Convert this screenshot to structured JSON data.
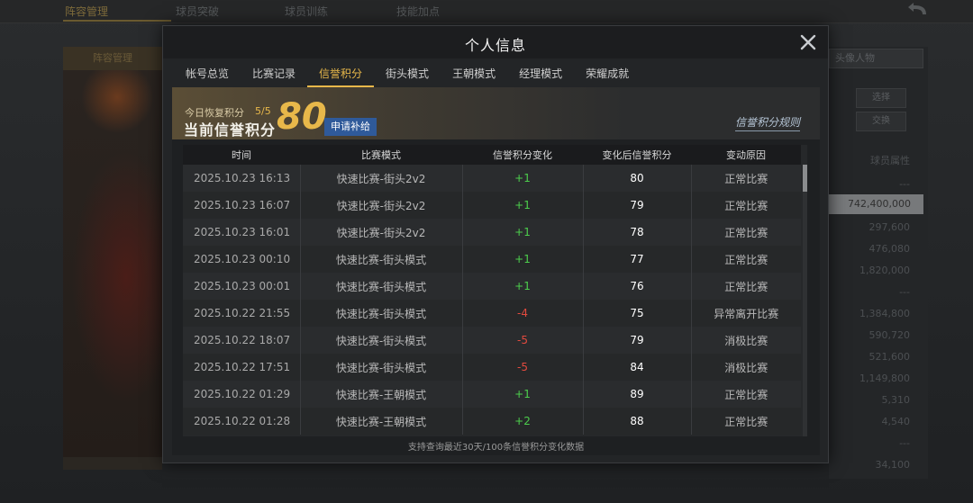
{
  "background": {
    "tabs": [
      "阵容管理",
      "球员突破",
      "球员训练",
      "技能加点"
    ],
    "left_header": "阵容管理",
    "right_select": "头像人物",
    "right_buttons": [
      "选择",
      "交换"
    ],
    "right_header": "球员属性",
    "right_values": [
      "---",
      "742,400,000",
      "297,600",
      "476,080",
      "1,820,000",
      "---",
      "1,384,800",
      "590,720",
      "521,600",
      "1,149,800",
      "5,310",
      "4,540",
      "---",
      "34,100"
    ]
  },
  "modal": {
    "title": "个人信息",
    "tabs": [
      {
        "label": "帐号总览",
        "active": false
      },
      {
        "label": "比赛记录",
        "active": false
      },
      {
        "label": "信誉积分",
        "active": true
      },
      {
        "label": "街头模式",
        "active": false
      },
      {
        "label": "王朝模式",
        "active": false
      },
      {
        "label": "经理模式",
        "active": false
      },
      {
        "label": "荣耀成就",
        "active": false
      }
    ],
    "banner": {
      "recover_label": "今日恢复积分",
      "recover_value": "5/5",
      "current_label": "当前信誉积分",
      "current_score": "80",
      "apply_button": "申请补给",
      "rules_link": "信誉积分规则"
    },
    "table": {
      "headers": [
        "时间",
        "比赛模式",
        "信誉积分变化",
        "变化后信誉积分",
        "变动原因"
      ],
      "rows": [
        {
          "time": "2025.10.23  16:13",
          "mode": "快速比赛-街头2v2",
          "change": "+1",
          "after": "80",
          "reason": "正常比赛",
          "sign": "pos"
        },
        {
          "time": "2025.10.23  16:07",
          "mode": "快速比赛-街头2v2",
          "change": "+1",
          "after": "79",
          "reason": "正常比赛",
          "sign": "pos"
        },
        {
          "time": "2025.10.23  16:01",
          "mode": "快速比赛-街头2v2",
          "change": "+1",
          "after": "78",
          "reason": "正常比赛",
          "sign": "pos"
        },
        {
          "time": "2025.10.23  00:10",
          "mode": "快速比赛-街头模式",
          "change": "+1",
          "after": "77",
          "reason": "正常比赛",
          "sign": "pos"
        },
        {
          "time": "2025.10.23  00:01",
          "mode": "快速比赛-街头模式",
          "change": "+1",
          "after": "76",
          "reason": "正常比赛",
          "sign": "pos"
        },
        {
          "time": "2025.10.22  21:55",
          "mode": "快速比赛-街头模式",
          "change": "-4",
          "after": "75",
          "reason": "异常离开比赛",
          "sign": "neg"
        },
        {
          "time": "2025.10.22  18:07",
          "mode": "快速比赛-街头模式",
          "change": "-5",
          "after": "79",
          "reason": "消极比赛",
          "sign": "neg"
        },
        {
          "time": "2025.10.22  17:51",
          "mode": "快速比赛-街头模式",
          "change": "-5",
          "after": "84",
          "reason": "消极比赛",
          "sign": "neg"
        },
        {
          "time": "2025.10.22  01:29",
          "mode": "快速比赛-王朝模式",
          "change": "+1",
          "after": "89",
          "reason": "正常比赛",
          "sign": "pos"
        },
        {
          "time": "2025.10.22  01:28",
          "mode": "快速比赛-王朝模式",
          "change": "+2",
          "after": "88",
          "reason": "正常比赛",
          "sign": "pos"
        }
      ]
    },
    "footer_note": "支持查询最近30天/100条信誉积分变化数据"
  },
  "colors": {
    "accent_gold": "#e8b84a",
    "positive": "#4ccd4c",
    "negative": "#e24a3e",
    "apply_button": "#2f5a9a"
  }
}
